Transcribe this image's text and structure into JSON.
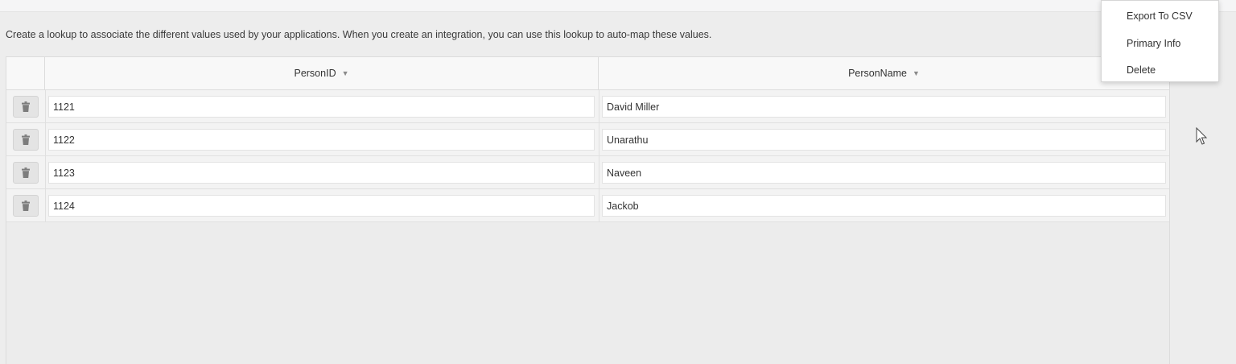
{
  "description": "Create a lookup to associate the different values used by your applications. When you create an integration, you can use this lookup to auto-map these values.",
  "table": {
    "columns": [
      {
        "label": "PersonID"
      },
      {
        "label": "PersonName"
      }
    ],
    "rows": [
      {
        "person_id": "1121",
        "person_name": "David Miller"
      },
      {
        "person_id": "1122",
        "person_name": "Unarathu"
      },
      {
        "person_id": "1123",
        "person_name": "Naveen"
      },
      {
        "person_id": "1124",
        "person_name": "Jackob"
      }
    ],
    "row_action_icon": "trash-icon",
    "sort_icon": "caret-down-icon"
  },
  "context_menu": {
    "items": [
      {
        "label": "Export To CSV"
      },
      {
        "label": "Primary Info"
      },
      {
        "label": "Delete"
      }
    ]
  },
  "colors": {
    "background": "#ededed",
    "header_background": "#f8f8f8",
    "input_background": "#ffffff",
    "text": "#333333"
  }
}
